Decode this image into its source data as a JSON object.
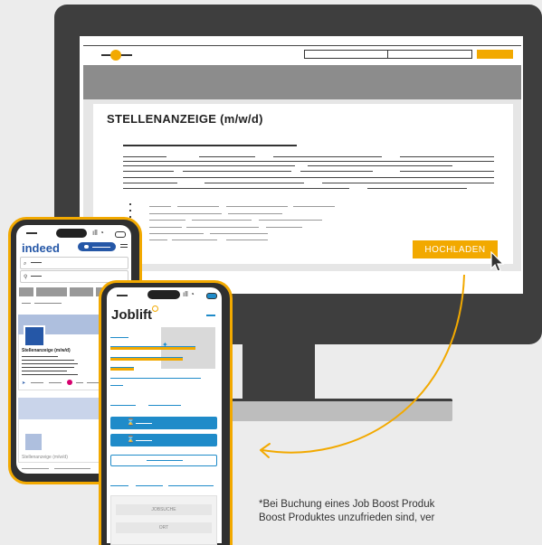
{
  "desktop": {
    "posting_title": "STELLENANZEIGE (m/w/d)",
    "upload_button": "HOCHLADEN",
    "colors": {
      "accent": "#f2a900",
      "monitor": "#3e3e3e",
      "band": "#8c8c8c"
    }
  },
  "indeed_phone": {
    "brand": "indeed",
    "card_title": "Stellenanzeige (m/w/d)",
    "card2_title": "Stellenanzeige (m/w/d)",
    "colors": {
      "brand": "#2557a7",
      "pin": "#d6006e"
    }
  },
  "joblift_phone": {
    "brand": "Joblift",
    "search_button": "JOBSUCHE",
    "location_button": "ORT",
    "colors": {
      "primary": "#1f8bc9"
    }
  },
  "notice": {
    "line1": "*Bei Buchung eines Job Boost Produk",
    "line2": "Boost Produktes unzufrieden sind, ver"
  }
}
